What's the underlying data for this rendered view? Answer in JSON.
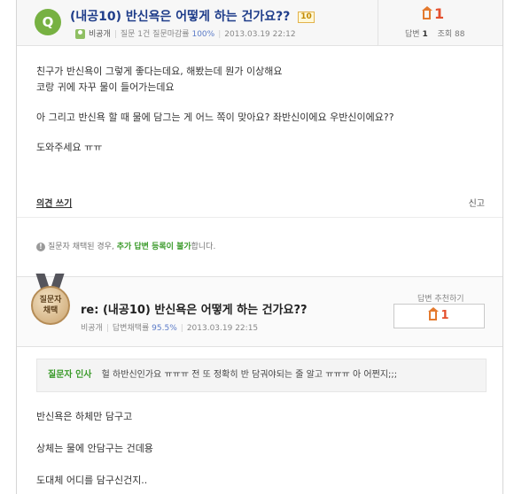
{
  "question": {
    "badge": "Q",
    "title": "(내공10) 반신욕은 어떻게 하는 건가요??",
    "points": "10",
    "author": "비공개",
    "meta_stats": "질문 1건 질문마감률",
    "close_rate": "100%",
    "datetime": "2013.03.19 22:12",
    "answer_count_big": "1",
    "answers_label": "답변",
    "answers_value": "1",
    "views_label": "조회",
    "views_value": "88",
    "body": [
      "친구가 반신욕이 그렇게 좋다는데요, 해봤는데 뭔가 이상해요",
      "코랑 귀에 자꾸 물이 들어가는데요",
      "아 그리고 반신욕 할 때 물에 담그는 게 어느 쪽이 맞아요? 좌반신이에요 우반신이에요??",
      "도와주세요 ㅠㅠ"
    ],
    "opinion_link": "의견 쓰기",
    "report_link": "신고"
  },
  "notice": {
    "icon": "info-icon",
    "prefix": "질문자 채택된 경우,",
    "highlight": "추가 답변 등록이 불가",
    "suffix": "합니다."
  },
  "answer": {
    "medal_line1": "질문자",
    "medal_line2": "채택",
    "title": "re: (내공10) 반신욕은 어떻게 하는 건가요??",
    "author": "비공개",
    "adopt_label": "답변채택률",
    "adopt_rate": "95.5%",
    "datetime": "2013.03.19 22:15",
    "recommend_label": "답변 추천하기",
    "recommend_count": "1",
    "greeting_label": "질문자 인사",
    "greeting_text": "헐 하반신인가요 ㅠㅠㅠ 전 또 정확히 반 담궈야되는 줄 알고 ㅠㅠㅠ 아 어쩐지;;;",
    "body": [
      "반신욕은 하체만 담구고",
      "상체는 물에 안담구는 건데용",
      "도대체 어디를 담구신건지.."
    ]
  },
  "colors": {
    "title_blue": "#1f3d8a",
    "accent_green": "#3a9a2a",
    "count_red": "#e4502e"
  }
}
